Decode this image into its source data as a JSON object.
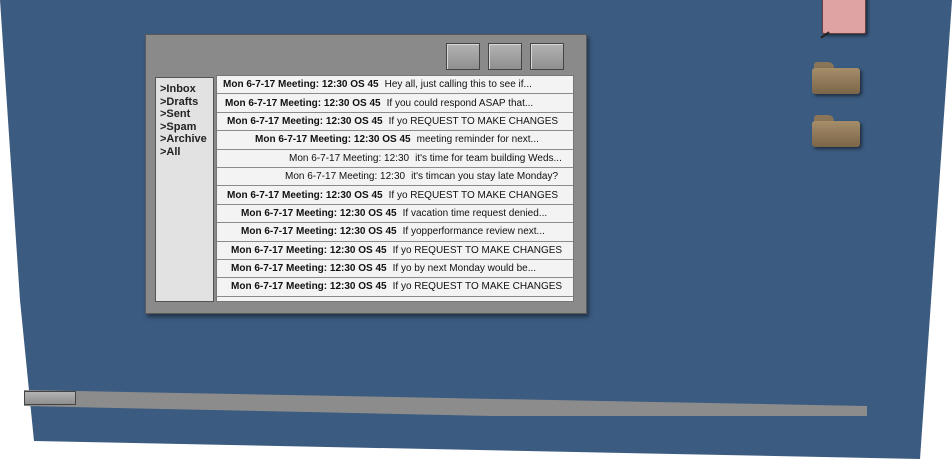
{
  "sidebar": {
    "folders": [
      ">Inbox",
      ">Drafts",
      ">Sent",
      ">Spam",
      ">Archive",
      ">All"
    ]
  },
  "messages": [
    {
      "header": "Mon 6-7-17 Meeting: 12:30 OS 45",
      "preview": "Hey all, just calling this to see if...",
      "unread": true
    },
    {
      "header": "Mon 6-7-17 Meeting: 12:30 OS 45",
      "preview": "If you could respond ASAP that...",
      "unread": true
    },
    {
      "header": "Mon 6-7-17 Meeting: 12:30 OS 45",
      "preview": "If yo REQUEST TO MAKE CHANGES",
      "unread": true
    },
    {
      "header": "Mon 6-7-17 Meeting: 12:30 OS 45",
      "preview": "meeting reminder for next...",
      "unread": true
    },
    {
      "header": "Mon 6-7-17 Meeting: 12:30",
      "preview": "it's time for team building Weds...",
      "unread": false
    },
    {
      "header": "Mon 6-7-17 Meeting: 12:30",
      "preview": "it's timcan you stay late Monday?",
      "unread": false
    },
    {
      "header": "Mon 6-7-17 Meeting: 12:30 OS 45",
      "preview": "If yo REQUEST TO MAKE CHANGES",
      "unread": true
    },
    {
      "header": "Mon 6-7-17 Meeting: 12:30 OS 45",
      "preview": "If vacation time request denied...",
      "unread": true
    },
    {
      "header": "Mon 6-7-17 Meeting: 12:30 OS 45",
      "preview": "If yopperformance review next...",
      "unread": true
    },
    {
      "header": "Mon 6-7-17 Meeting: 12:30 OS 45",
      "preview": "If yo REQUEST TO MAKE CHANGES",
      "unread": true
    },
    {
      "header": "Mon 6-7-17 Meeting: 12:30 OS 45",
      "preview": "If yo by next Monday would be...",
      "unread": true
    },
    {
      "header": "Mon 6-7-17 Meeting: 12:30 OS 45",
      "preview": "If yo REQUEST TO MAKE CHANGES",
      "unread": true
    }
  ],
  "icons": {
    "window_buttons": [
      "minimize-icon",
      "maximize-icon",
      "close-icon"
    ],
    "desktop": [
      "trash-icon",
      "folder-icon",
      "folder-icon"
    ]
  },
  "colors": {
    "desktop": "#3b5b80",
    "window": "#8a8a8a",
    "list_background": "#f3f3f3",
    "trash": "#e0a3a3",
    "folder": "#8a7558"
  }
}
